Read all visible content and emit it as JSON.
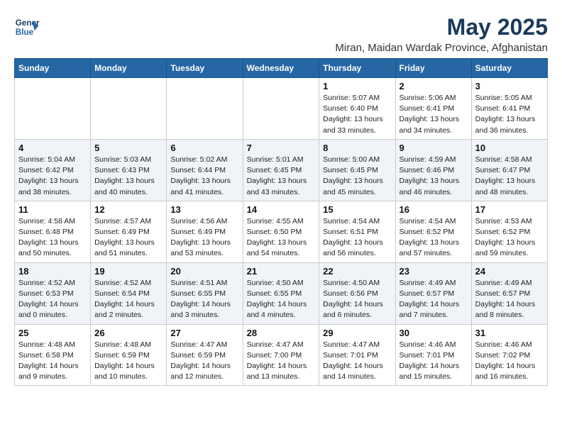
{
  "header": {
    "logo_line1": "General",
    "logo_line2": "Blue",
    "month": "May 2025",
    "location": "Miran, Maidan Wardak Province, Afghanistan"
  },
  "weekdays": [
    "Sunday",
    "Monday",
    "Tuesday",
    "Wednesday",
    "Thursday",
    "Friday",
    "Saturday"
  ],
  "weeks": [
    [
      {
        "day": "",
        "info": ""
      },
      {
        "day": "",
        "info": ""
      },
      {
        "day": "",
        "info": ""
      },
      {
        "day": "",
        "info": ""
      },
      {
        "day": "1",
        "info": "Sunrise: 5:07 AM\nSunset: 6:40 PM\nDaylight: 13 hours\nand 33 minutes."
      },
      {
        "day": "2",
        "info": "Sunrise: 5:06 AM\nSunset: 6:41 PM\nDaylight: 13 hours\nand 34 minutes."
      },
      {
        "day": "3",
        "info": "Sunrise: 5:05 AM\nSunset: 6:41 PM\nDaylight: 13 hours\nand 36 minutes."
      }
    ],
    [
      {
        "day": "4",
        "info": "Sunrise: 5:04 AM\nSunset: 6:42 PM\nDaylight: 13 hours\nand 38 minutes."
      },
      {
        "day": "5",
        "info": "Sunrise: 5:03 AM\nSunset: 6:43 PM\nDaylight: 13 hours\nand 40 minutes."
      },
      {
        "day": "6",
        "info": "Sunrise: 5:02 AM\nSunset: 6:44 PM\nDaylight: 13 hours\nand 41 minutes."
      },
      {
        "day": "7",
        "info": "Sunrise: 5:01 AM\nSunset: 6:45 PM\nDaylight: 13 hours\nand 43 minutes."
      },
      {
        "day": "8",
        "info": "Sunrise: 5:00 AM\nSunset: 6:45 PM\nDaylight: 13 hours\nand 45 minutes."
      },
      {
        "day": "9",
        "info": "Sunrise: 4:59 AM\nSunset: 6:46 PM\nDaylight: 13 hours\nand 46 minutes."
      },
      {
        "day": "10",
        "info": "Sunrise: 4:58 AM\nSunset: 6:47 PM\nDaylight: 13 hours\nand 48 minutes."
      }
    ],
    [
      {
        "day": "11",
        "info": "Sunrise: 4:58 AM\nSunset: 6:48 PM\nDaylight: 13 hours\nand 50 minutes."
      },
      {
        "day": "12",
        "info": "Sunrise: 4:57 AM\nSunset: 6:49 PM\nDaylight: 13 hours\nand 51 minutes."
      },
      {
        "day": "13",
        "info": "Sunrise: 4:56 AM\nSunset: 6:49 PM\nDaylight: 13 hours\nand 53 minutes."
      },
      {
        "day": "14",
        "info": "Sunrise: 4:55 AM\nSunset: 6:50 PM\nDaylight: 13 hours\nand 54 minutes."
      },
      {
        "day": "15",
        "info": "Sunrise: 4:54 AM\nSunset: 6:51 PM\nDaylight: 13 hours\nand 56 minutes."
      },
      {
        "day": "16",
        "info": "Sunrise: 4:54 AM\nSunset: 6:52 PM\nDaylight: 13 hours\nand 57 minutes."
      },
      {
        "day": "17",
        "info": "Sunrise: 4:53 AM\nSunset: 6:52 PM\nDaylight: 13 hours\nand 59 minutes."
      }
    ],
    [
      {
        "day": "18",
        "info": "Sunrise: 4:52 AM\nSunset: 6:53 PM\nDaylight: 14 hours\nand 0 minutes."
      },
      {
        "day": "19",
        "info": "Sunrise: 4:52 AM\nSunset: 6:54 PM\nDaylight: 14 hours\nand 2 minutes."
      },
      {
        "day": "20",
        "info": "Sunrise: 4:51 AM\nSunset: 6:55 PM\nDaylight: 14 hours\nand 3 minutes."
      },
      {
        "day": "21",
        "info": "Sunrise: 4:50 AM\nSunset: 6:55 PM\nDaylight: 14 hours\nand 4 minutes."
      },
      {
        "day": "22",
        "info": "Sunrise: 4:50 AM\nSunset: 6:56 PM\nDaylight: 14 hours\nand 6 minutes."
      },
      {
        "day": "23",
        "info": "Sunrise: 4:49 AM\nSunset: 6:57 PM\nDaylight: 14 hours\nand 7 minutes."
      },
      {
        "day": "24",
        "info": "Sunrise: 4:49 AM\nSunset: 6:57 PM\nDaylight: 14 hours\nand 8 minutes."
      }
    ],
    [
      {
        "day": "25",
        "info": "Sunrise: 4:48 AM\nSunset: 6:58 PM\nDaylight: 14 hours\nand 9 minutes."
      },
      {
        "day": "26",
        "info": "Sunrise: 4:48 AM\nSunset: 6:59 PM\nDaylight: 14 hours\nand 10 minutes."
      },
      {
        "day": "27",
        "info": "Sunrise: 4:47 AM\nSunset: 6:59 PM\nDaylight: 14 hours\nand 12 minutes."
      },
      {
        "day": "28",
        "info": "Sunrise: 4:47 AM\nSunset: 7:00 PM\nDaylight: 14 hours\nand 13 minutes."
      },
      {
        "day": "29",
        "info": "Sunrise: 4:47 AM\nSunset: 7:01 PM\nDaylight: 14 hours\nand 14 minutes."
      },
      {
        "day": "30",
        "info": "Sunrise: 4:46 AM\nSunset: 7:01 PM\nDaylight: 14 hours\nand 15 minutes."
      },
      {
        "day": "31",
        "info": "Sunrise: 4:46 AM\nSunset: 7:02 PM\nDaylight: 14 hours\nand 16 minutes."
      }
    ]
  ]
}
